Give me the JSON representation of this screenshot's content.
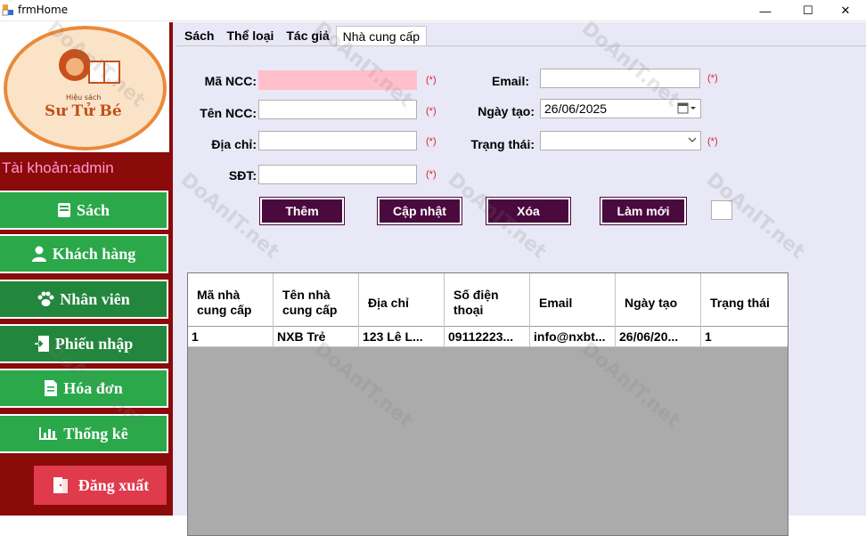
{
  "window": {
    "title": "frmHome",
    "minimize_label": "—",
    "maximize_label": "☐",
    "close_label": "✕"
  },
  "logo": {
    "subtitle": "Hiệu sách",
    "brand": "Sư Tử Bé"
  },
  "sidebar": {
    "account": "Tài khoản:admin",
    "items": [
      {
        "label": "Sách",
        "icon": "book-icon"
      },
      {
        "label": "Khách hàng",
        "icon": "user-icon"
      },
      {
        "label": "Nhân viên",
        "icon": "paw-icon"
      },
      {
        "label": "Phiếu nhập",
        "icon": "import-icon"
      },
      {
        "label": "Hóa đơn",
        "icon": "invoice-icon"
      },
      {
        "label": "Thống kê",
        "icon": "chart-icon"
      }
    ],
    "logout": "Đăng xuất"
  },
  "tabs": [
    "Sách",
    "Thể loại",
    "Tác giả",
    "Nhà cung cấp"
  ],
  "form": {
    "ma_ncc": {
      "label": "Mã NCC:",
      "value": ""
    },
    "ten_ncc": {
      "label": "Tên NCC:",
      "value": ""
    },
    "dia_chi": {
      "label": "Địa chỉ:",
      "value": ""
    },
    "sdt": {
      "label": "SĐT:",
      "value": ""
    },
    "email": {
      "label": "Email:",
      "value": ""
    },
    "ngay_tao": {
      "label": "Ngày tạo:",
      "value": "26/06/2025"
    },
    "trang_thai": {
      "label": "Trạng thái:",
      "value": ""
    },
    "required_mark": "(*)"
  },
  "actions": {
    "add": "Thêm",
    "update": "Cập nhật",
    "delete": "Xóa",
    "refresh": "Làm mới"
  },
  "table": {
    "columns": [
      "Mã nhà cung cấp",
      "Tên nhà cung cấp",
      "Địa chỉ",
      "Số điện thoại",
      "Email",
      "Ngày tạo",
      "Trạng thái"
    ],
    "rows": [
      [
        "1",
        "NXB Trẻ",
        "123 Lê L...",
        "09112223...",
        "info@nxbt...",
        "26/06/20...",
        "1"
      ]
    ]
  },
  "watermark": "DoAnIT.net",
  "colors": {
    "sidebar": "#8b0a0a",
    "nav_button": "#2aa84a",
    "logout": "#e03a4d",
    "action_button": "#4a0a3e",
    "required": "#e0202a"
  }
}
